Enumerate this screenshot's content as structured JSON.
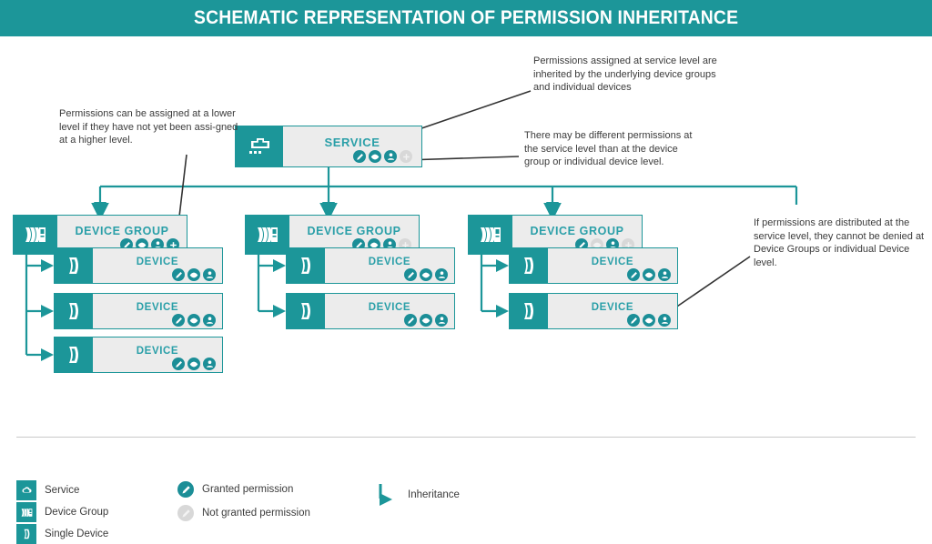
{
  "header": {
    "title": "SCHEMATIC REPRESENTATION OF PERMISSION INHERITANCE"
  },
  "colors": {
    "brand_teal": "#1c9699",
    "label_teal": "#2a9fa8",
    "granted": "#1b8e97",
    "not_granted": "#d8d8d8",
    "box_fill": "#ececec",
    "text": "#3b3b3b",
    "callout_line": "#333333"
  },
  "annotations": [
    {
      "id": "lower-level-note",
      "text": "Permissions can be assigned at a lower level if they have not yet been assi-gned at a higher level."
    },
    {
      "id": "service-inheritance-note",
      "text": "Permissions assigned at service level are inherited by the underlying device groups and individual devices"
    },
    {
      "id": "different-permissions-note",
      "text": "There may be different permissions at the service level than at the device group or individual device level."
    },
    {
      "id": "cannot-be-denied-note",
      "text": "If permissions are distributed at the service level, they cannot be denied at Device Groups or individual Device level."
    }
  ],
  "service": {
    "label": "SERVICE",
    "icon": "cloud-icon",
    "permissions": [
      {
        "icon": "pencil-icon",
        "granted": true
      },
      {
        "icon": "eye-icon",
        "granted": true
      },
      {
        "icon": "user-icon",
        "granted": true
      },
      {
        "icon": "plus-icon",
        "granted": false
      }
    ]
  },
  "device_groups": [
    {
      "label": "DEVICE GROUP",
      "icon": "device-group-icon",
      "permissions": [
        {
          "icon": "pencil-icon",
          "granted": true
        },
        {
          "icon": "eye-icon",
          "granted": true
        },
        {
          "icon": "user-icon",
          "granted": true
        },
        {
          "icon": "plus-icon",
          "granted": true
        }
      ],
      "devices": [
        {
          "label": "DEVICE",
          "icon": "single-device-icon",
          "permissions": [
            {
              "icon": "pencil-icon",
              "granted": true
            },
            {
              "icon": "eye-icon",
              "granted": true
            },
            {
              "icon": "user-icon",
              "granted": true
            }
          ]
        },
        {
          "label": "DEVICE",
          "icon": "single-device-icon",
          "permissions": [
            {
              "icon": "pencil-icon",
              "granted": true
            },
            {
              "icon": "eye-icon",
              "granted": true
            },
            {
              "icon": "user-icon",
              "granted": true
            }
          ]
        },
        {
          "label": "DEVICE",
          "icon": "single-device-icon",
          "permissions": [
            {
              "icon": "pencil-icon",
              "granted": true
            },
            {
              "icon": "eye-icon",
              "granted": true
            },
            {
              "icon": "user-icon",
              "granted": true
            }
          ]
        }
      ]
    },
    {
      "label": "DEVICE GROUP",
      "icon": "device-group-icon",
      "permissions": [
        {
          "icon": "pencil-icon",
          "granted": true
        },
        {
          "icon": "eye-icon",
          "granted": true
        },
        {
          "icon": "user-icon",
          "granted": true
        },
        {
          "icon": "plus-icon",
          "granted": false
        }
      ],
      "devices": [
        {
          "label": "DEVICE",
          "icon": "single-device-icon",
          "permissions": [
            {
              "icon": "pencil-icon",
              "granted": true
            },
            {
              "icon": "eye-icon",
              "granted": true
            },
            {
              "icon": "user-icon",
              "granted": true
            }
          ]
        },
        {
          "label": "DEVICE",
          "icon": "single-device-icon",
          "permissions": [
            {
              "icon": "pencil-icon",
              "granted": true
            },
            {
              "icon": "eye-icon",
              "granted": true
            },
            {
              "icon": "user-icon",
              "granted": true
            }
          ]
        }
      ]
    },
    {
      "label": "DEVICE GROUP",
      "icon": "device-group-icon",
      "permissions": [
        {
          "icon": "pencil-icon",
          "granted": true
        },
        {
          "icon": "eye-icon",
          "granted": false
        },
        {
          "icon": "user-icon",
          "granted": true
        },
        {
          "icon": "plus-icon",
          "granted": false
        }
      ],
      "devices": [
        {
          "label": "DEVICE",
          "icon": "single-device-icon",
          "permissions": [
            {
              "icon": "pencil-icon",
              "granted": true
            },
            {
              "icon": "eye-icon",
              "granted": true
            },
            {
              "icon": "user-icon",
              "granted": true
            }
          ]
        },
        {
          "label": "DEVICE",
          "icon": "single-device-icon",
          "permissions": [
            {
              "icon": "pencil-icon",
              "granted": true
            },
            {
              "icon": "eye-icon",
              "granted": true
            },
            {
              "icon": "user-icon",
              "granted": true
            }
          ]
        }
      ]
    }
  ],
  "legend": {
    "shapes": [
      {
        "icon": "cloud-icon",
        "label": "Service"
      },
      {
        "icon": "device-group-icon",
        "label": "Device Group"
      },
      {
        "icon": "single-device-icon",
        "label": "Single Device"
      }
    ],
    "permissions": [
      {
        "icon": "pencil-icon",
        "granted": true,
        "label": "Granted permission"
      },
      {
        "icon": "pencil-icon",
        "granted": false,
        "label": "Not granted permission"
      }
    ],
    "arrow": {
      "icon": "inheritance-arrow-icon",
      "label": "Inheritance"
    }
  }
}
